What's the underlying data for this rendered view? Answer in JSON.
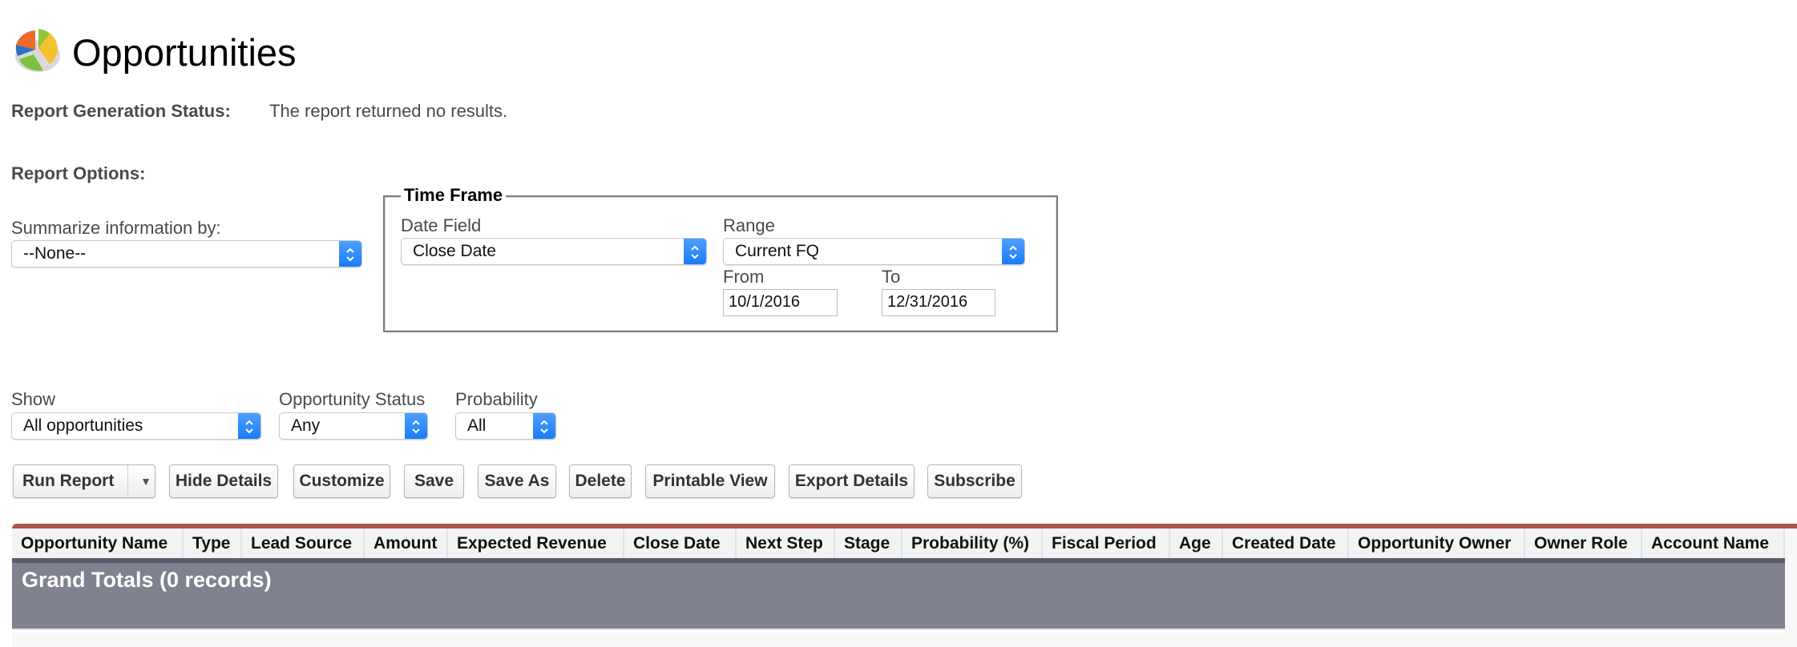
{
  "header": {
    "title": "Opportunities",
    "logo_icon": "pie-chart-icon"
  },
  "status": {
    "label": "Report Generation Status:",
    "text": "The report returned no results."
  },
  "report_options": {
    "label": "Report Options:",
    "summarize": {
      "label": "Summarize information by:",
      "value": "--None--"
    },
    "time_frame": {
      "legend": "Time Frame",
      "date_field": {
        "label": "Date Field",
        "value": "Close Date"
      },
      "range": {
        "label": "Range",
        "value": "Current FQ"
      },
      "from": {
        "label": "From",
        "value": "10/1/2016"
      },
      "to": {
        "label": "To",
        "value": "12/31/2016"
      }
    }
  },
  "filters": {
    "show": {
      "label": "Show",
      "value": "All opportunities"
    },
    "opportunity_status": {
      "label": "Opportunity Status",
      "value": "Any"
    },
    "probability": {
      "label": "Probability",
      "value": "All"
    }
  },
  "toolbar": {
    "run_report": "Run Report",
    "hide_details": "Hide Details",
    "customize": "Customize",
    "save": "Save",
    "save_as": "Save As",
    "delete": "Delete",
    "printable_view": "Printable View",
    "export_details": "Export Details",
    "subscribe": "Subscribe"
  },
  "table": {
    "columns": [
      "Opportunity Name",
      "Type",
      "Lead Source",
      "Amount",
      "Expected Revenue",
      "Close Date",
      "Next Step",
      "Stage",
      "Probability (%)",
      "Fiscal Period",
      "Age",
      "Created Date",
      "Opportunity Owner",
      "Owner Role",
      "Account Name"
    ],
    "grand_totals": "Grand Totals (0 records)"
  },
  "colors": {
    "accent_bar": "#a8574a",
    "totals_row": "#808290",
    "select_arrow": "#1a7bfa"
  }
}
